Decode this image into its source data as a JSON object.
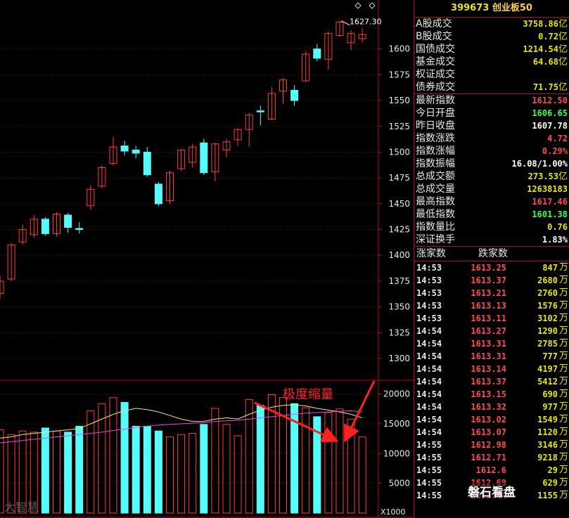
{
  "panel": {
    "code": "399673",
    "name": "创业板50",
    "top_rows": [
      {
        "label": "A股成交",
        "value": "3758.86",
        "unit": "亿",
        "color": "y"
      },
      {
        "label": "B股成交",
        "value": "0.72",
        "unit": "亿",
        "color": "y"
      },
      {
        "label": "国债成交",
        "value": "1214.54",
        "unit": "亿",
        "color": "y"
      },
      {
        "label": "基金成交",
        "value": "64.68",
        "unit": "亿",
        "color": "y"
      },
      {
        "label": "权证成交",
        "value": "",
        "unit": "",
        "color": "y"
      },
      {
        "label": "债券成交",
        "value": "71.75",
        "unit": "亿",
        "color": "y"
      }
    ],
    "index_rows": [
      {
        "label": "最新指数",
        "value": "1612.50",
        "unit": "",
        "color": "r"
      },
      {
        "label": "今日开盘",
        "value": "1606.65",
        "unit": "",
        "color": "g"
      },
      {
        "label": "昨日收盘",
        "value": "1607.78",
        "unit": "",
        "color": "w"
      },
      {
        "label": "指数涨跌",
        "value": "4.72",
        "unit": "",
        "color": "r"
      },
      {
        "label": "指数涨幅",
        "value": "0.29%",
        "unit": "",
        "color": "r"
      },
      {
        "label": "指数振幅",
        "value": "16.08/1.00%",
        "unit": "",
        "color": "w"
      },
      {
        "label": "总成交额",
        "value": "273.53",
        "unit": "亿",
        "color": "y"
      },
      {
        "label": "总成交量",
        "value": "12638183",
        "unit": "",
        "color": "y"
      },
      {
        "label": "最高指数",
        "value": "1617.46",
        "unit": "",
        "color": "r"
      },
      {
        "label": "最低指数",
        "value": "1601.38",
        "unit": "",
        "color": "g"
      },
      {
        "label": "指数量比",
        "value": "0.76",
        "unit": "",
        "color": "y"
      },
      {
        "label": "深证换手",
        "value": "1.83%",
        "unit": "",
        "color": "w"
      }
    ],
    "tick_header": {
      "up": "涨家数",
      "down": "跌家数"
    },
    "ticks": [
      {
        "time": "14:53",
        "price": "1613.25",
        "vol": "847"
      },
      {
        "time": "14:53",
        "price": "1613.37",
        "vol": "2680"
      },
      {
        "time": "14:53",
        "price": "1613.21",
        "vol": "2760"
      },
      {
        "time": "14:53",
        "price": "1613.13",
        "vol": "1576"
      },
      {
        "time": "14:53",
        "price": "1613.11",
        "vol": "3102"
      },
      {
        "time": "14:54",
        "price": "1613.27",
        "vol": "1290"
      },
      {
        "time": "14:54",
        "price": "1613.31",
        "vol": "2785"
      },
      {
        "time": "14:54",
        "price": "1613.31",
        "vol": "777"
      },
      {
        "time": "14:54",
        "price": "1613.14",
        "vol": "4197"
      },
      {
        "time": "14:54",
        "price": "1613.37",
        "vol": "5412"
      },
      {
        "time": "14:54",
        "price": "1613.15",
        "vol": "690"
      },
      {
        "time": "14:54",
        "price": "1613.32",
        "vol": "977"
      },
      {
        "time": "14:54",
        "price": "1613.02",
        "vol": "1549"
      },
      {
        "time": "14:54",
        "price": "1613.07",
        "vol": "1120"
      },
      {
        "time": "14:55",
        "price": "1612.98",
        "vol": "3146"
      },
      {
        "time": "14:55",
        "price": "1612.71",
        "vol": "9218"
      },
      {
        "time": "14:55",
        "price": "1612.6",
        "vol": "29"
      },
      {
        "time": "14:55",
        "price": "1612.69",
        "vol": "629"
      },
      {
        "time": "14:55",
        "price": "1612.44",
        "vol": "1155"
      }
    ],
    "tick_unit": "万"
  },
  "chart_data": {
    "type": "candlestick",
    "high_annotation": "1627.30",
    "price_axis": {
      "ticks": [
        "1600",
        "1575",
        "1550",
        "1525",
        "1500",
        "1475",
        "1450",
        "1425",
        "1400",
        "1375",
        "1350",
        "1325",
        "1300"
      ],
      "range": [
        1283,
        1642
      ]
    },
    "volume_axis": {
      "ticks": [
        "20000",
        "15000",
        "10000",
        "5000"
      ],
      "multiplier": "X1000",
      "range": [
        0,
        21500
      ]
    },
    "candles": [
      {
        "o": 1363,
        "c": 1375,
        "h": 1380,
        "l": 1358
      },
      {
        "o": 1377,
        "c": 1410,
        "h": 1412,
        "l": 1375
      },
      {
        "o": 1413,
        "c": 1425,
        "h": 1430,
        "l": 1410
      },
      {
        "o": 1420,
        "c": 1435,
        "h": 1439,
        "l": 1417
      },
      {
        "o": 1435,
        "c": 1421,
        "h": 1437,
        "l": 1419
      },
      {
        "o": 1421,
        "c": 1440,
        "h": 1442,
        "l": 1418
      },
      {
        "o": 1439,
        "c": 1427,
        "h": 1441,
        "l": 1422
      },
      {
        "o": 1426,
        "c": 1425,
        "h": 1432,
        "l": 1421
      },
      {
        "o": 1448,
        "c": 1464,
        "h": 1468,
        "l": 1444
      },
      {
        "o": 1467,
        "c": 1485,
        "h": 1487,
        "l": 1465
      },
      {
        "o": 1489,
        "c": 1505,
        "h": 1515,
        "l": 1487
      },
      {
        "o": 1506,
        "c": 1501,
        "h": 1511,
        "l": 1497
      },
      {
        "o": 1502,
        "c": 1499,
        "h": 1506,
        "l": 1494
      },
      {
        "o": 1500,
        "c": 1478,
        "h": 1505,
        "l": 1476
      },
      {
        "o": 1469,
        "c": 1450,
        "h": 1471,
        "l": 1448
      },
      {
        "o": 1453,
        "c": 1480,
        "h": 1482,
        "l": 1450
      },
      {
        "o": 1484,
        "c": 1502,
        "h": 1503,
        "l": 1482
      },
      {
        "o": 1490,
        "c": 1505,
        "h": 1508,
        "l": 1485
      },
      {
        "o": 1509,
        "c": 1480,
        "h": 1513,
        "l": 1478
      },
      {
        "o": 1481,
        "c": 1508,
        "h": 1509,
        "l": 1472
      },
      {
        "o": 1502,
        "c": 1510,
        "h": 1513,
        "l": 1495
      },
      {
        "o": 1512,
        "c": 1522,
        "h": 1523,
        "l": 1506
      },
      {
        "o": 1522,
        "c": 1536,
        "h": 1538,
        "l": 1505
      },
      {
        "o": 1540,
        "c": 1539,
        "h": 1545,
        "l": 1526
      },
      {
        "o": 1532,
        "c": 1557,
        "h": 1563,
        "l": 1531
      },
      {
        "o": 1559,
        "c": 1570,
        "h": 1572,
        "l": 1547
      },
      {
        "o": 1560,
        "c": 1550,
        "h": 1565,
        "l": 1545
      },
      {
        "o": 1569,
        "c": 1595,
        "h": 1598,
        "l": 1568
      },
      {
        "o": 1600,
        "c": 1591,
        "h": 1605,
        "l": 1588
      },
      {
        "o": 1590,
        "c": 1615,
        "h": 1617,
        "l": 1580
      },
      {
        "o": 1613,
        "c": 1626,
        "h": 1627.3,
        "l": 1612
      },
      {
        "o": 1606,
        "c": 1615,
        "h": 1618,
        "l": 1599
      },
      {
        "o": 1610,
        "c": 1614,
        "h": 1620,
        "l": 1606
      }
    ],
    "volumes": [
      14000,
      13200,
      13800,
      13600,
      14300,
      13800,
      13600,
      14600,
      17200,
      18400,
      19400,
      18600,
      14600,
      14600,
      13800,
      12800,
      13200,
      13400,
      14900,
      17600,
      14900,
      13000,
      19100,
      18100,
      19900,
      19400,
      18400,
      17700,
      16200,
      16900,
      17500,
      15800,
      12800
    ],
    "ma_lines": [
      {
        "color": "#f5e96a",
        "values": [
          12600,
          12800,
          13200,
          13400,
          13600,
          13800,
          14000,
          14200,
          15000,
          15800,
          16600,
          17200,
          17600,
          17400,
          17000,
          16400,
          15800,
          15400,
          15400,
          15800,
          16000,
          15800,
          16600,
          17300,
          17800,
          18100,
          18200,
          18000,
          17600,
          17300,
          17000,
          16600,
          16000
        ]
      },
      {
        "color": "#e04be0",
        "values": [
          11800,
          12000,
          12200,
          12400,
          12600,
          12800,
          13000,
          13200,
          13400,
          13600,
          13900,
          14100,
          14400,
          14600,
          14800,
          14900,
          15000,
          15100,
          15200,
          15400,
          15500,
          15600,
          15800,
          16000,
          16200,
          16400,
          16600,
          16800,
          16900,
          17000,
          17100,
          17200,
          17000
        ]
      }
    ],
    "annotation": "极度缩量"
  },
  "watermarks": {
    "left": "大智慧",
    "right": "磐石看盘"
  }
}
